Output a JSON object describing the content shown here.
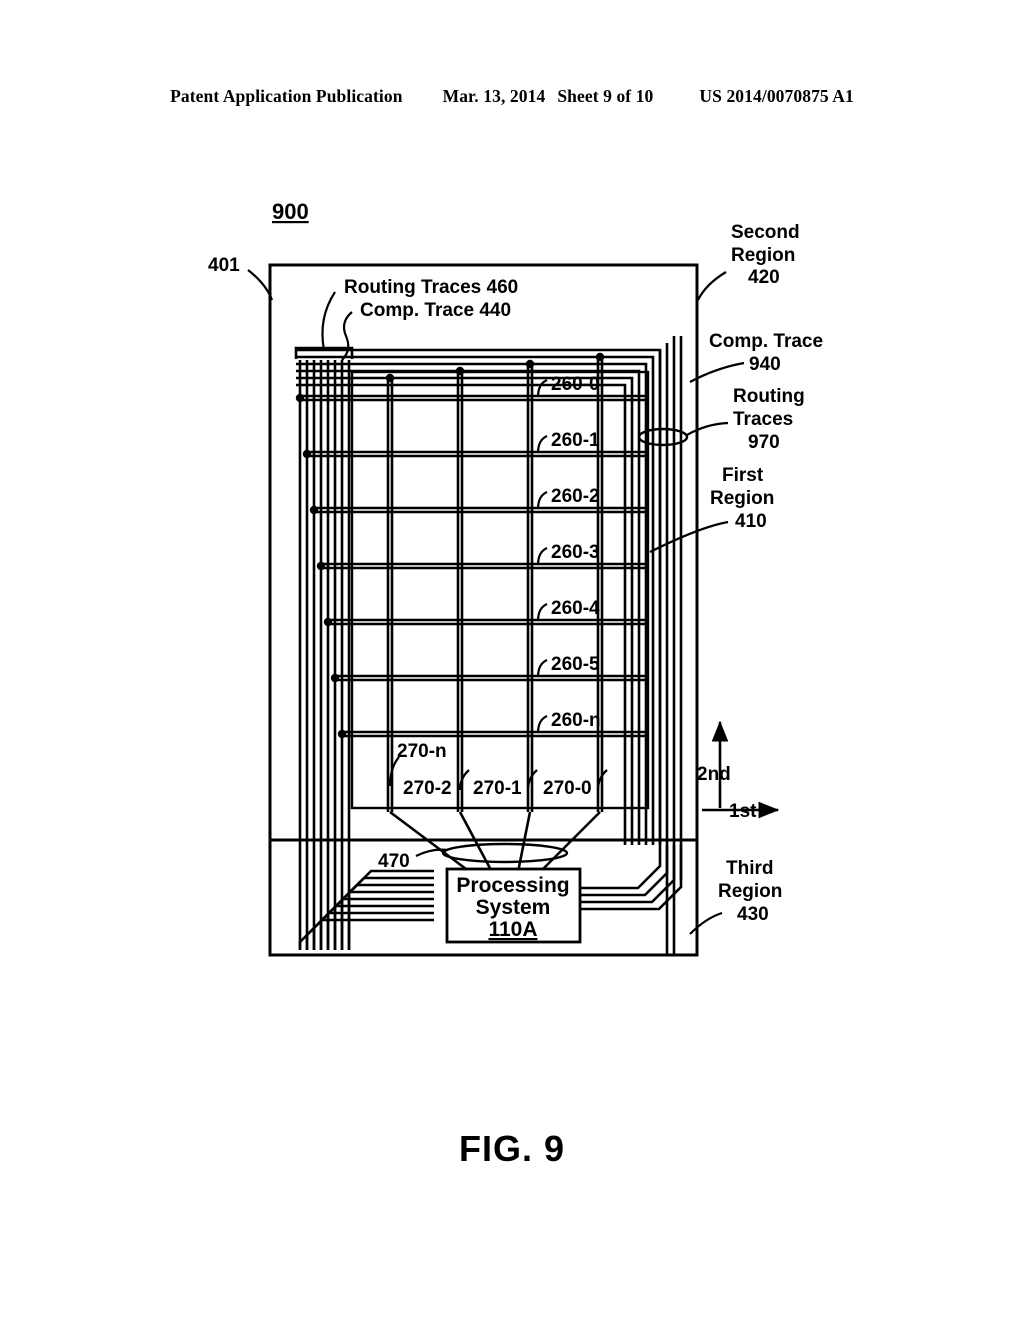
{
  "header": {
    "left": "Patent Application Publication",
    "date": "Mar. 13, 2014",
    "sheet": "Sheet 9 of 10",
    "pubnum": "US 2014/0070875 A1"
  },
  "figure": {
    "caption": "FIG. 9",
    "ref_number": "900",
    "device_ref": "401"
  },
  "labels": {
    "routing_traces_460": "Routing Traces 460",
    "comp_trace_440": "Comp. Trace 440",
    "second_region_l1": "Second",
    "second_region_l2": "Region",
    "second_region_num": "420",
    "comp_trace_940_l1": "Comp. Trace",
    "comp_trace_940_num": "940",
    "routing_traces_970_l1": "Routing",
    "routing_traces_970_l2": "Traces",
    "routing_traces_970_num": "970",
    "first_region_l1": "First",
    "first_region_l2": "Region",
    "first_region_num": "410",
    "third_region_l1": "Third",
    "third_region_l2": "Region",
    "third_region_num": "430",
    "sensor_bundle_470": "470",
    "axis_second": "2nd",
    "axis_first": "1st"
  },
  "processing_system": {
    "line1": "Processing",
    "line2": "System",
    "ref": "110A"
  },
  "row_electrodes": [
    "260-0",
    "260-1",
    "260-2",
    "260-3",
    "260-4",
    "260-5",
    "260-n"
  ],
  "column_electrodes": [
    "270-n",
    "270-2",
    "270-1",
    "270-0"
  ],
  "colors": {
    "ink": "#000000",
    "paper": "#ffffff"
  }
}
